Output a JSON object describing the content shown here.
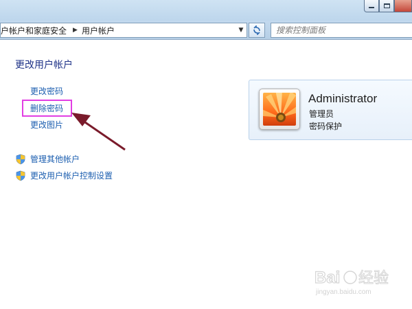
{
  "breadcrumb": {
    "items": [
      "户帐户和家庭安全",
      "用户帐户"
    ]
  },
  "search": {
    "placeholder": "搜索控制面板"
  },
  "main": {
    "title": "更改用户帐户",
    "links": {
      "change_password": "更改密码",
      "remove_password": "删除密码",
      "change_picture": "更改图片"
    },
    "shield_links": {
      "manage_accounts": "管理其他帐户",
      "uac_settings": "更改用户帐户控制设置"
    }
  },
  "account": {
    "name": "Administrator",
    "role": "管理员",
    "status": "密码保护"
  },
  "watermark": {
    "logo": "Baidu经验",
    "domain": "jingyan.baidu.com"
  },
  "colors": {
    "link": "#1d5fb0",
    "title": "#1e3287",
    "highlight": "#e23ee3",
    "arrow": "#7a1b2b"
  }
}
